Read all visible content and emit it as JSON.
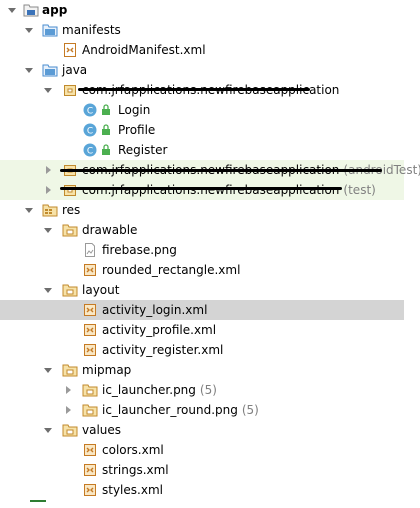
{
  "tree": {
    "root": {
      "label": "app"
    },
    "manifests": {
      "label": "manifests",
      "files": [
        "AndroidManifest.xml"
      ]
    },
    "java": {
      "label": "java",
      "main_pkg": {
        "label": "com.jrfapplications.newfirebaseapplication"
      },
      "classes": [
        "Login",
        "Profile",
        "Register"
      ],
      "android_test_pkg": {
        "label": "com.jrfapplications.newfirebaseapplication",
        "suffix": "(androidTest)"
      },
      "test_pkg": {
        "label": "com.jrfapplications.newfirebaseapplication",
        "suffix": "(test)"
      }
    },
    "res": {
      "label": "res",
      "drawable": {
        "label": "drawable",
        "files": [
          "firebase.png",
          "rounded_rectangle.xml"
        ]
      },
      "layout": {
        "label": "layout",
        "files": [
          "activity_login.xml",
          "activity_profile.xml",
          "activity_register.xml"
        ]
      },
      "mipmap": {
        "label": "mipmap",
        "items": [
          {
            "label": "ic_launcher.png",
            "count": "(5)"
          },
          {
            "label": "ic_launcher_round.png",
            "count": "(5)"
          }
        ]
      },
      "values": {
        "label": "values",
        "files": [
          "colors.xml",
          "strings.xml",
          "styles.xml"
        ]
      }
    }
  },
  "colors": {
    "selection": "#d4d4d4",
    "test_row": "#eff7e6",
    "folder": "#d9a441",
    "class_icon": "#59a5d8",
    "lock": "#4caf50"
  }
}
